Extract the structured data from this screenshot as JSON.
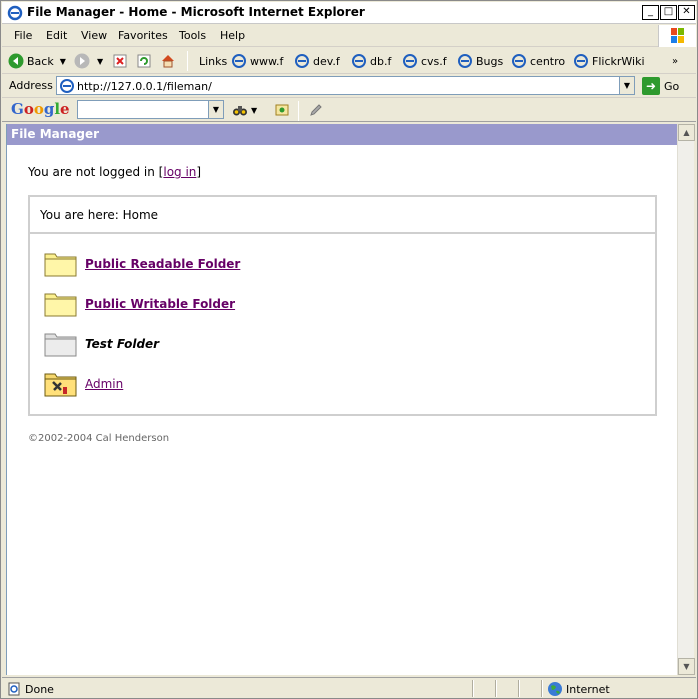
{
  "window": {
    "title": "File Manager - Home - Microsoft Internet Explorer",
    "buttons": {
      "minimize": "_",
      "maximize": "□",
      "close": "✕"
    }
  },
  "menu": [
    "File",
    "Edit",
    "View",
    "Favorites",
    "Tools",
    "Help"
  ],
  "toolbar": {
    "back_label": "Back",
    "links_label": "Links",
    "links": [
      "www.f",
      "dev.f",
      "db.f",
      "cvs.f",
      "Bugs",
      "centro",
      "FlickrWiki"
    ]
  },
  "address": {
    "label": "Address",
    "url": "http://127.0.0.1/fileman/",
    "go_label": "Go"
  },
  "google": {
    "logo_letters": [
      "G",
      "o",
      "o",
      "g",
      "l",
      "e"
    ],
    "search_value": ""
  },
  "page": {
    "header": "File Manager",
    "login_prefix": "You are not logged in [",
    "login_link": "log in",
    "login_suffix": "]",
    "breadcrumb": "You are here: Home",
    "folders": [
      {
        "label": "Public Readable Folder",
        "style": "link",
        "icon": "folder-yellow-icon"
      },
      {
        "label": "Public Writable Folder",
        "style": "link",
        "icon": "folder-yellow-icon"
      },
      {
        "label": "Test Folder",
        "style": "italic",
        "icon": "folder-gray-icon"
      },
      {
        "label": "Admin",
        "style": "link-plain",
        "icon": "admin-folder-icon"
      }
    ],
    "footer": "©2002-2004 Cal Henderson"
  },
  "status": {
    "text": "Done",
    "zone": "Internet"
  },
  "colors": {
    "header_bg": "#9999cc",
    "link": "#660066"
  }
}
